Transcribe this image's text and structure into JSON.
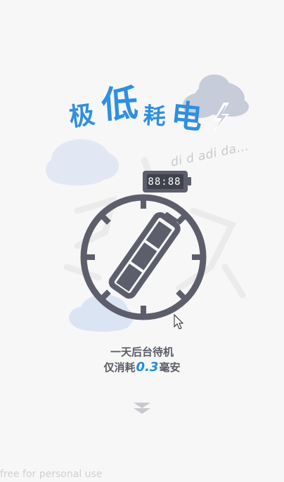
{
  "headline": {
    "char1": "极",
    "char2": "低",
    "char3": "耗",
    "char4": "电"
  },
  "sound_effect": "di d adi da...",
  "clock_readout": "88:88",
  "caption": {
    "line1": "一天后台待机",
    "line2_prefix": "仅消耗",
    "line2_value": "0.3",
    "line2_suffix": "毫安"
  },
  "scroll_hint_icon": "double-chevron-down-icon",
  "watermark": "free for personal use",
  "colors": {
    "accent": "#2f8fe0",
    "dial": "#5c5f6b",
    "cloud": "#dbe4f2",
    "cloud_dark": "#c5cbd8"
  }
}
